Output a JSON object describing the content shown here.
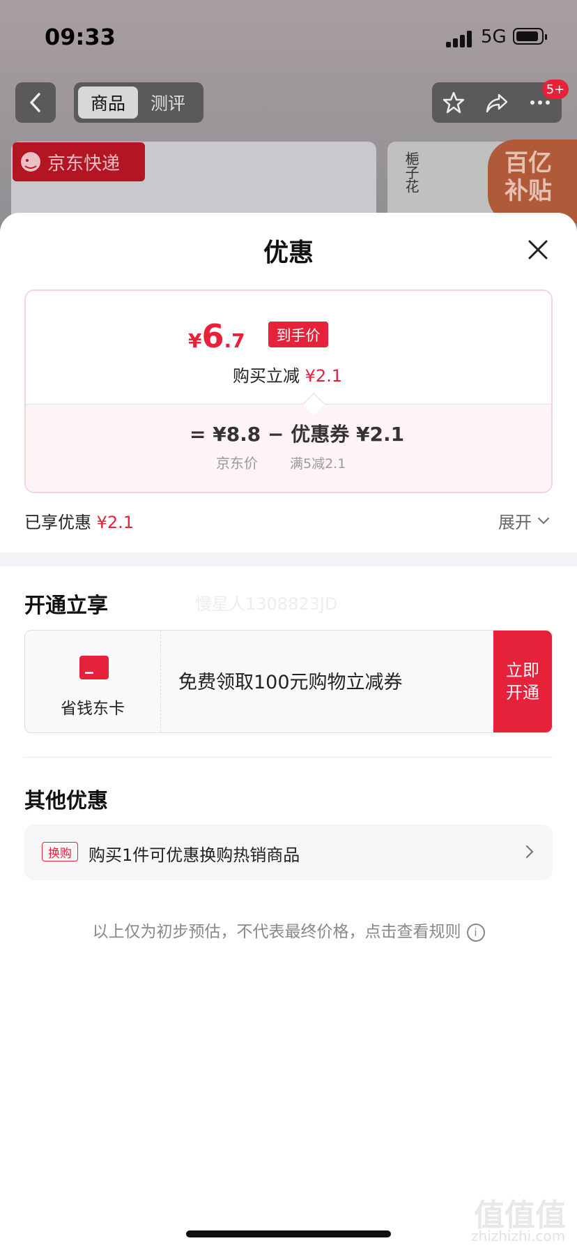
{
  "status": {
    "time": "09:33",
    "network": "5G"
  },
  "nav": {
    "tabs": [
      {
        "label": "商品"
      },
      {
        "label": "测评"
      }
    ],
    "badge": "5+"
  },
  "promo": {
    "jd_tag": "京东快递",
    "product_text": "梔子花",
    "subsidy_line1": "百亿",
    "subsidy_line2": "补贴"
  },
  "sheet": {
    "title": "优惠",
    "price": {
      "currency": "¥",
      "integer": "6",
      "decimal": ".7",
      "tag": "到手价"
    },
    "reduce": {
      "label": "购买立减",
      "amount": "¥2.1"
    },
    "formula": {
      "text": "=  ¥8.8  −  优惠券 ¥2.1",
      "jd_price_label": "京东价",
      "coupon_rule": "满5减2.1"
    },
    "enjoyed": {
      "label": "已享优惠",
      "amount": "¥2.1",
      "expand": "展开"
    },
    "open_section": {
      "title": "开通立享",
      "watermark": "慢星人1308823JD",
      "card": {
        "name": "省钱东卡",
        "desc": "免费领取100元购物立减券",
        "button_line1": "立即",
        "button_line2": "开通"
      }
    },
    "other_section": {
      "title": "其他优惠",
      "item": {
        "tag": "换购",
        "text": "购买1件可优惠换购热销商品"
      }
    },
    "disclaimer": "以上仅为初步预估，不代表最终价格，点击查看规则",
    "disclaimer_icon": "i"
  },
  "watermark_logo": {
    "text": "值值值",
    "url": "zhizhizhi.com"
  },
  "colors": {
    "accent": "#e6213a",
    "price_bg": "#fff4f5"
  },
  "icons": [
    "back-icon",
    "star-icon",
    "share-icon",
    "more-icon",
    "close-icon",
    "chevron-down-icon",
    "chevron-right-icon",
    "card-icon",
    "info-icon"
  ]
}
